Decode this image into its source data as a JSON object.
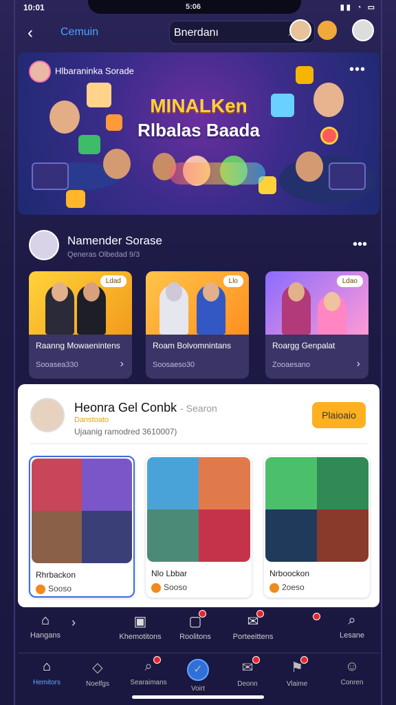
{
  "status": {
    "time": "10:01",
    "center": "5:06",
    "icons": "▮▮ ◔ ▭"
  },
  "topbar": {
    "title": "Cemuin",
    "search_value": "Bnerdanı",
    "search_icon": "magnifier-icon",
    "clear_icon": "close-icon"
  },
  "banner": {
    "owner": "Hlbaraninka Sorade",
    "title_line1": "MINALKen",
    "title_line2": "Rlbalas Baada",
    "more": "•••"
  },
  "section": {
    "title": "Namender Sorase",
    "subtitle": "Qeneras Olbedad 9/3",
    "more": "•••",
    "cards": [
      {
        "tag": "Ldad",
        "title": "Raanng Mowaenintens",
        "meta": "Sooasea330"
      },
      {
        "tag": "Llo",
        "title": "Roam Bolvomnintans",
        "meta": "Soosaeso30"
      },
      {
        "tag": "Ldao",
        "title": "Roargg Genpalat",
        "meta": "Zooaesano"
      }
    ]
  },
  "channel": {
    "name": "Heonra Gel Conbk",
    "name_suffix": "- Searon",
    "sub": "Danstoato",
    "meta": "Ujaanig ramodred 3610007)",
    "follow": "Plaioaio",
    "cards": [
      {
        "name": "Rhrbackon",
        "count": "Sooso"
      },
      {
        "name": "Nlo Lbbar",
        "count": "Sooso"
      },
      {
        "name": "Nrboockon",
        "count": "2oeso"
      }
    ]
  },
  "nav_upper": [
    {
      "label": "Hangans",
      "icon": "home-icon"
    },
    {
      "label": "Khemotitons",
      "icon": "calendar-icon"
    },
    {
      "label": "Roolitons",
      "icon": "bookmark-icon"
    },
    {
      "label": "Porteeittens",
      "icon": "mail-icon"
    },
    {
      "label": "",
      "icon": "alert-dot"
    },
    {
      "label": "Lesane",
      "icon": "search-icon"
    }
  ],
  "nav_upper_chevron": "›",
  "nav_lower": [
    {
      "label": "Hemitors",
      "icon": "home-icon"
    },
    {
      "label": "Noelfgs",
      "icon": "tag-icon"
    },
    {
      "label": "Searaimans",
      "icon": "search-icon"
    },
    {
      "label": "Voirt",
      "icon": "create-icon"
    },
    {
      "label": "Deonn",
      "icon": "inbox-icon"
    },
    {
      "label": "Vlaime",
      "icon": "flag-icon"
    },
    {
      "label": "Conren",
      "icon": "profile-icon"
    }
  ]
}
